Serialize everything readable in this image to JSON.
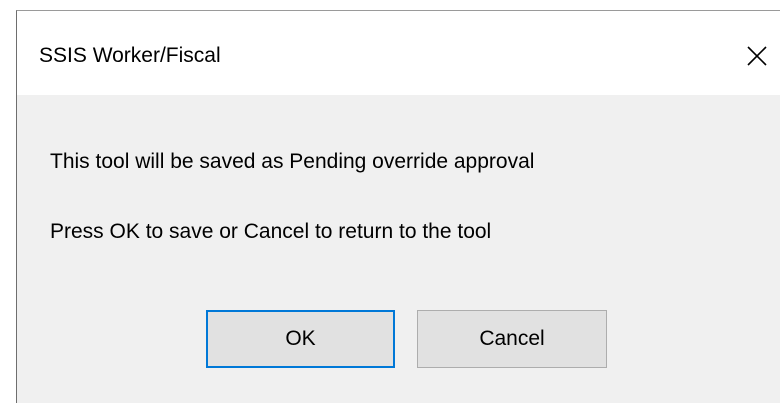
{
  "window": {
    "title": "SSIS Worker/Fiscal",
    "close_icon": "close-icon"
  },
  "message": {
    "line1": "This tool will be saved as Pending override approval",
    "line2": "Press OK to save or Cancel to return to the tool"
  },
  "buttons": {
    "ok_label": "OK",
    "cancel_label": "Cancel"
  },
  "colors": {
    "focus_border": "#0078d7",
    "button_face": "#e1e1e1",
    "client_background": "#f0f0f0",
    "titlebar_background": "#ffffff"
  }
}
